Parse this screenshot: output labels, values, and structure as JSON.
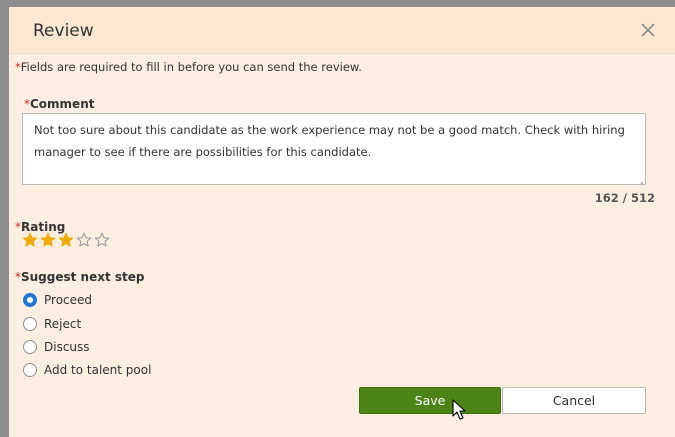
{
  "dialog": {
    "title": "Review",
    "required_marker": "*",
    "required_note": "Fields are required to fill in before you can send the review."
  },
  "comment": {
    "label": "Comment",
    "value": "Not too sure about this candidate as the work experience may not be a good match. Check with hiring manager to see if there are possibilities for this candidate.",
    "counter": "162 / 512"
  },
  "rating": {
    "label": "Rating",
    "value": 3,
    "max": 5,
    "filled_color": "#f2ac09",
    "empty_color": "#9a9a9a"
  },
  "next_step": {
    "label": "Suggest next step",
    "selected": "Proceed",
    "options": [
      "Proceed",
      "Reject",
      "Discuss",
      "Add to talent pool"
    ]
  },
  "buttons": {
    "save": "Save",
    "cancel": "Cancel"
  },
  "colors": {
    "header_bg": "#fbe7d2",
    "body_bg": "#fcefe2",
    "save_bg": "#4d8418",
    "radio_checked": "#1f76d6",
    "required": "#d9241e"
  },
  "icons": {
    "close": "close-icon",
    "star": "star-icon",
    "cursor": "cursor-pointer-icon"
  }
}
